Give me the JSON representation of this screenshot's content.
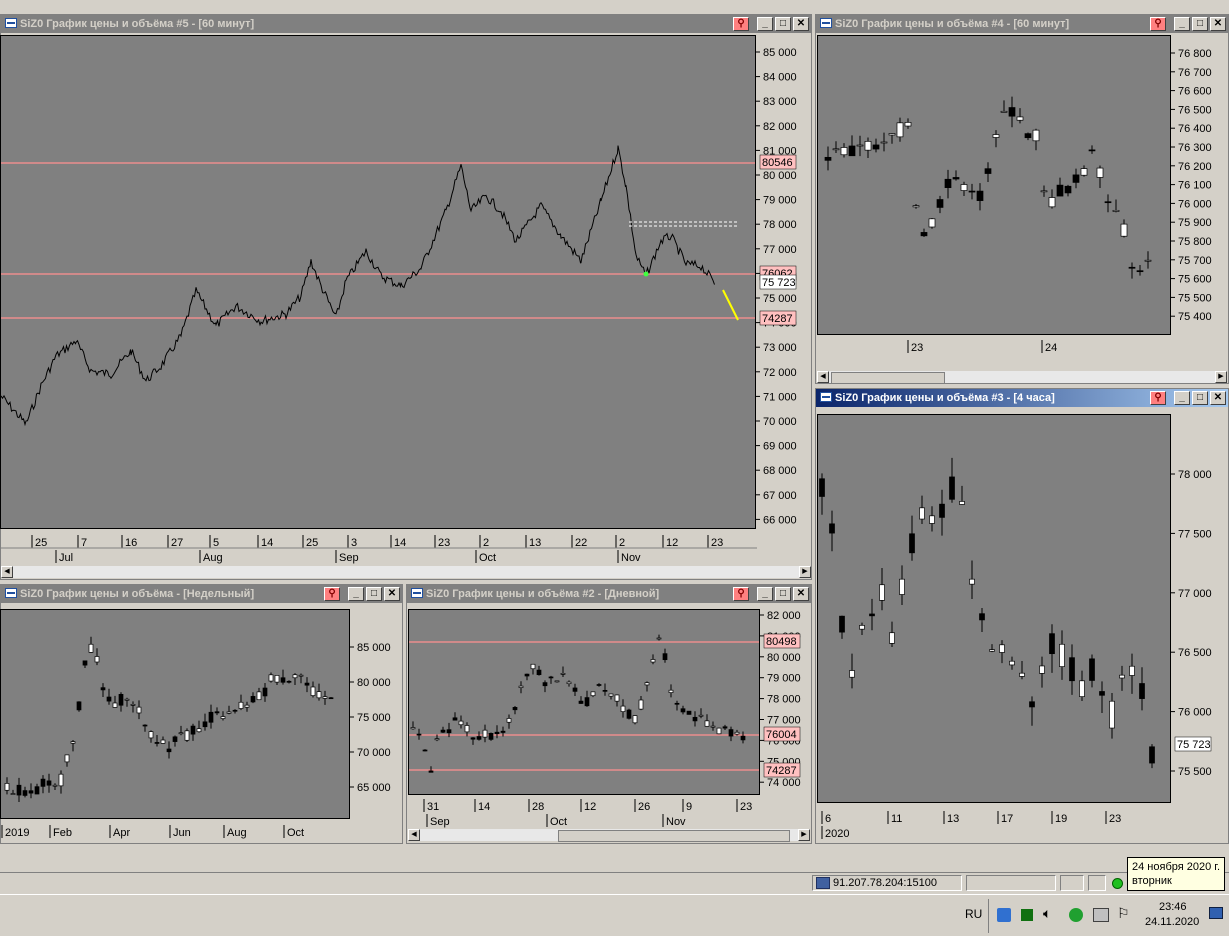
{
  "windows": {
    "w5": {
      "title": "SiZ0 График цены и объёма #5 - [60 минут]",
      "y_ticks": [
        "85 000",
        "84 000",
        "83 000",
        "82 000",
        "81 000",
        "80 000",
        "79 000",
        "78 000",
        "77 000",
        "76 000",
        "75 000",
        "74 000",
        "73 000",
        "72 000",
        "71 000",
        "70 000",
        "69 000",
        "68 000",
        "67 000",
        "66 000"
      ],
      "x_days": [
        "25",
        "7",
        "16",
        "27",
        "5",
        "14",
        "25",
        "3",
        "14",
        "23",
        "2",
        "13",
        "22",
        "2",
        "12",
        "23"
      ],
      "x_months": [
        "Jul",
        "Aug",
        "Sep",
        "Oct",
        "Nov"
      ],
      "price_labels": [
        "80546",
        "76062",
        "75 723",
        "74287"
      ]
    },
    "w4": {
      "title": "SiZ0 График цены и объёма #4 - [60 минут]",
      "y_ticks": [
        "76 800",
        "76 700",
        "76 600",
        "76 500",
        "76 400",
        "76 300",
        "76 200",
        "76 100",
        "76 000",
        "75 900",
        "75 800",
        "75 700",
        "75 600",
        "75 500",
        "75 400"
      ],
      "x_days": [
        "23",
        "24"
      ]
    },
    "w3": {
      "title": "SiZ0 График цены и объёма #3 - [4 часа]",
      "y_ticks": [
        "78 000",
        "77 500",
        "77 000",
        "76 500",
        "76 000",
        "75 500"
      ],
      "x_days": [
        "6",
        "11",
        "13",
        "17",
        "19",
        "23"
      ],
      "x_months": [
        "2020"
      ],
      "price_labels": [
        "75 723"
      ]
    },
    "ww": {
      "title": "SiZ0 График цены и объёма - [Недельный]",
      "y_ticks": [
        "85 000",
        "80 000",
        "75 000",
        "70 000",
        "65 000"
      ],
      "x_labels": [
        "2019",
        "Feb",
        "Apr",
        "Jun",
        "Aug",
        "Oct"
      ]
    },
    "w2": {
      "title": "SiZ0 График цены и объёма #2 - [Дневной]",
      "y_ticks": [
        "82 000",
        "81 000",
        "80 000",
        "79 000",
        "78 000",
        "77 000",
        "76 000",
        "75 000",
        "74 000"
      ],
      "x_days": [
        "31",
        "14",
        "28",
        "12",
        "26",
        "9",
        "23"
      ],
      "x_months": [
        "Sep",
        "Oct",
        "Nov"
      ],
      "price_labels": [
        "80498",
        "76004",
        "74287"
      ]
    }
  },
  "button_glyphs": {
    "link": "⚲",
    "minimize": "_",
    "maximize": "□",
    "close": "✕"
  },
  "status": {
    "server": "91.207.78.204:15100"
  },
  "tray": {
    "lang": "RU",
    "time": "23:46",
    "date": "24.11.2020"
  },
  "tooltip": {
    "line1": "24 ноября 2020 г.",
    "line2": "вторник"
  },
  "colors": {
    "plot_bg": "#808080",
    "level_line": "#ff9090",
    "candle_up": "#ffffff",
    "candle_down": "#000000",
    "trend_line": "#ffff00"
  }
}
